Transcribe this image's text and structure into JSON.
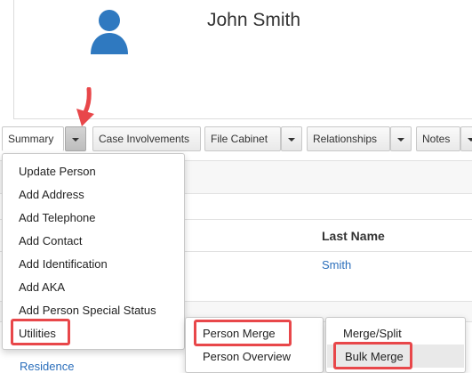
{
  "person": {
    "name": "John Smith"
  },
  "tabs": {
    "summary": "Summary",
    "case_involvements": "Case Involvements",
    "file_cabinet": "File Cabinet",
    "relationships": "Relationships",
    "notes": "Notes"
  },
  "table": {
    "column_last_name": "Last Name",
    "last_name_value": "Smith"
  },
  "addresses": {
    "residence_link": "Residence"
  },
  "summary_menu": {
    "items": [
      "Update Person",
      "Add Address",
      "Add Telephone",
      "Add Contact",
      "Add Identification",
      "Add AKA",
      "Add Person Special Status",
      "Utilities"
    ]
  },
  "utilities_submenu": {
    "items": [
      "Person Merge",
      "Person Overview"
    ]
  },
  "merge_submenu": {
    "items": [
      "Merge/Split",
      "Bulk Merge"
    ]
  },
  "colors": {
    "highlight_red": "#e8474a",
    "link_blue": "#2a6ebb",
    "avatar_blue": "#2f79c0"
  }
}
